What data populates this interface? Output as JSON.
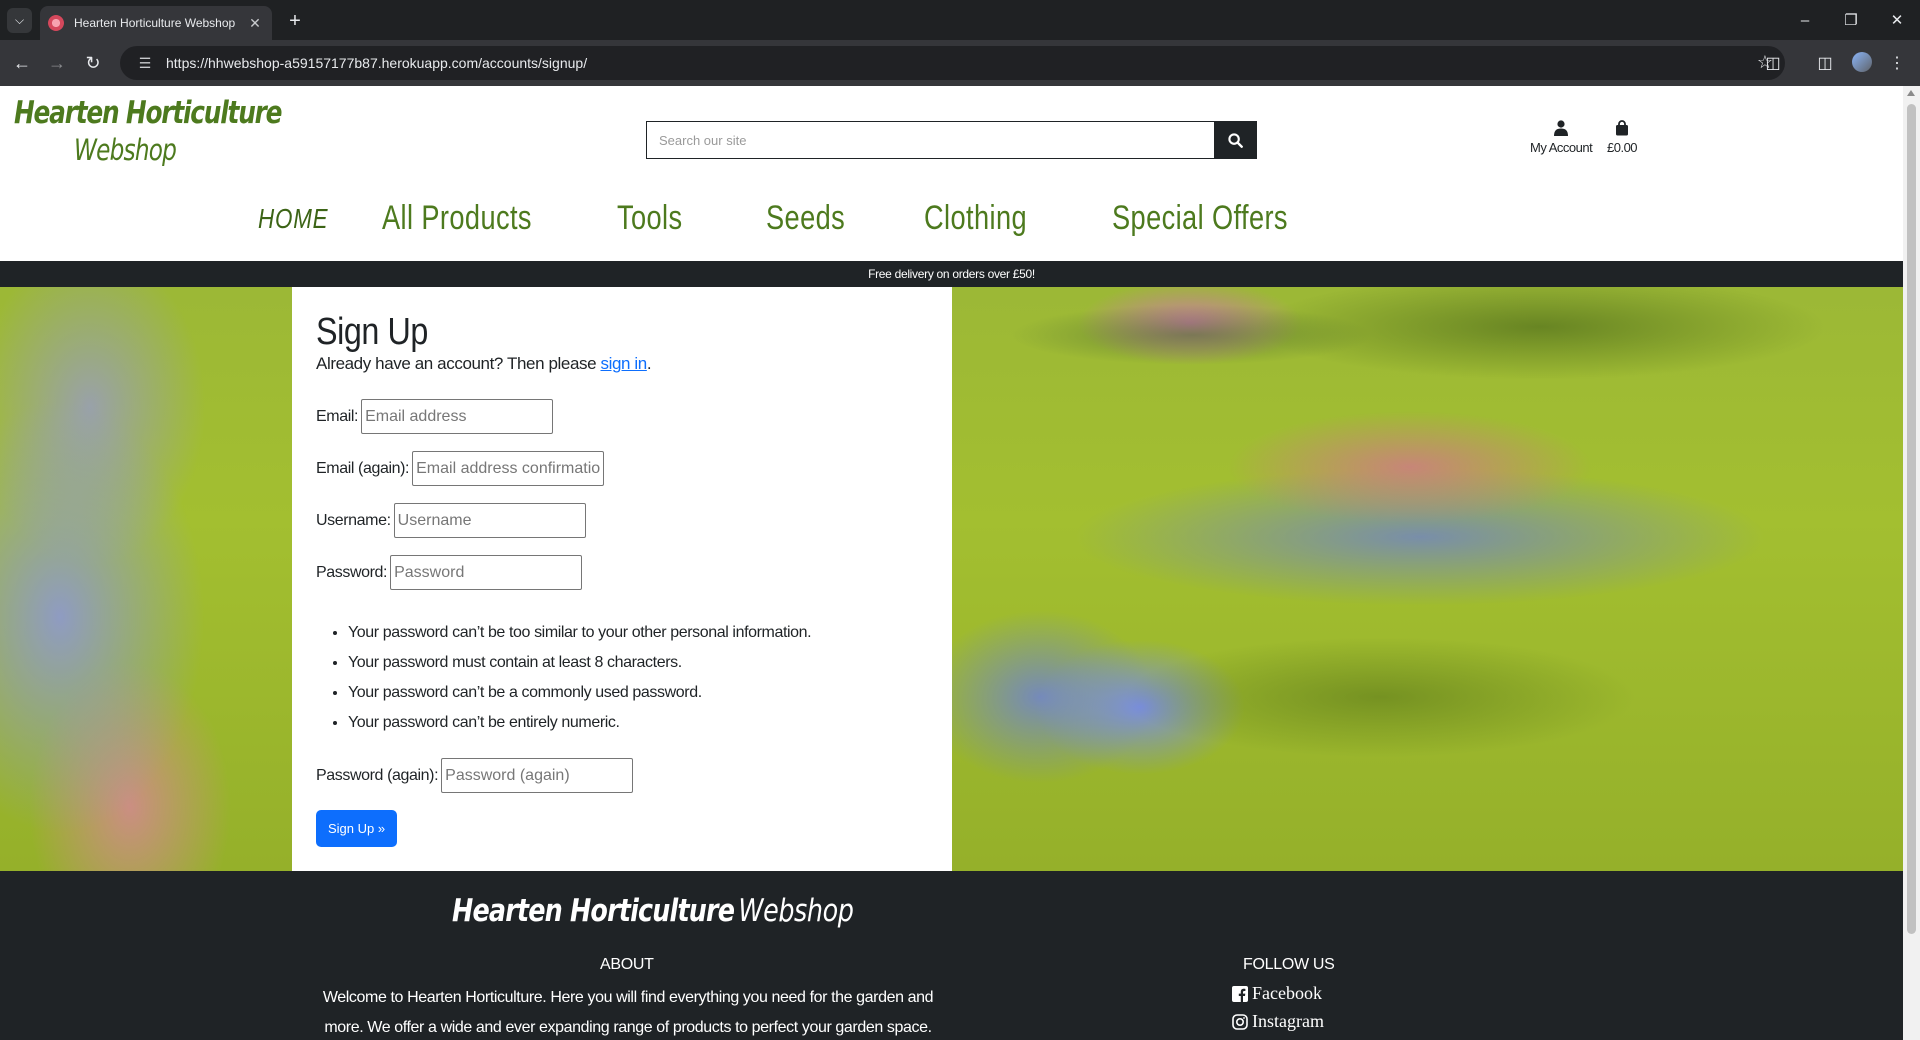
{
  "browser": {
    "tab_title": "Hearten Horticulture Webshop",
    "url": "https://hhwebshop-a59157177b87.herokuapp.com/accounts/signup/"
  },
  "site": {
    "logo_line1": "Hearten Horticulture",
    "logo_line2": "Webshop",
    "search_placeholder": "Search our site",
    "account_label": "My Account",
    "basket_total": "£0.00",
    "nav": {
      "home": "HOME",
      "all_products": "All Products",
      "tools": "Tools",
      "seeds": "Seeds",
      "clothing": "Clothing",
      "special_offers": "Special Offers"
    },
    "banner": "Free delivery on orders over £50!"
  },
  "signup": {
    "title": "Sign Up",
    "already_prefix": "Already have an account? Then please",
    "sign_in_link": "sign in",
    "already_suffix": ".",
    "email_label": "Email:",
    "email_placeholder": "Email address",
    "email2_label": "Email (again):",
    "email2_placeholder": "Email address confirmation",
    "username_label": "Username:",
    "username_placeholder": "Username",
    "password_label": "Password:",
    "password_placeholder": "Password",
    "password_help": [
      "Your password can’t be too similar to your other personal information.",
      "Your password must contain at least 8 characters.",
      "Your password can’t be a commonly used password.",
      "Your password can’t be entirely numeric."
    ],
    "password2_label": "Password (again):",
    "password2_placeholder": "Password (again)",
    "submit_label": "Sign Up »"
  },
  "footer": {
    "logo_part1": "Hearten Horticulture",
    "logo_part2": "Webshop",
    "about_title": "ABOUT",
    "about_text": "Welcome to Hearten Horticulture. Here you will find everything you need for the garden and more. We offer a wide and ever expanding range of products to perfect your garden space.",
    "follow_title": "FOLLOW US",
    "facebook": "Facebook",
    "instagram": "Instagram"
  },
  "colors": {
    "brand_green": "#4d7a1e",
    "dark": "#1f2326",
    "link_blue": "#0d6efd"
  },
  "icons": [
    "chevron-down-icon",
    "favicon-icon",
    "close-icon",
    "plus-icon",
    "minimize-icon",
    "restore-icon",
    "back-icon",
    "forward-icon",
    "reload-icon",
    "site-info-icon",
    "star-icon",
    "extensions-icon",
    "sidepanel-icon",
    "profile-icon",
    "menu-icon",
    "search-icon",
    "user-icon",
    "bag-icon",
    "facebook-icon",
    "instagram-icon"
  ]
}
